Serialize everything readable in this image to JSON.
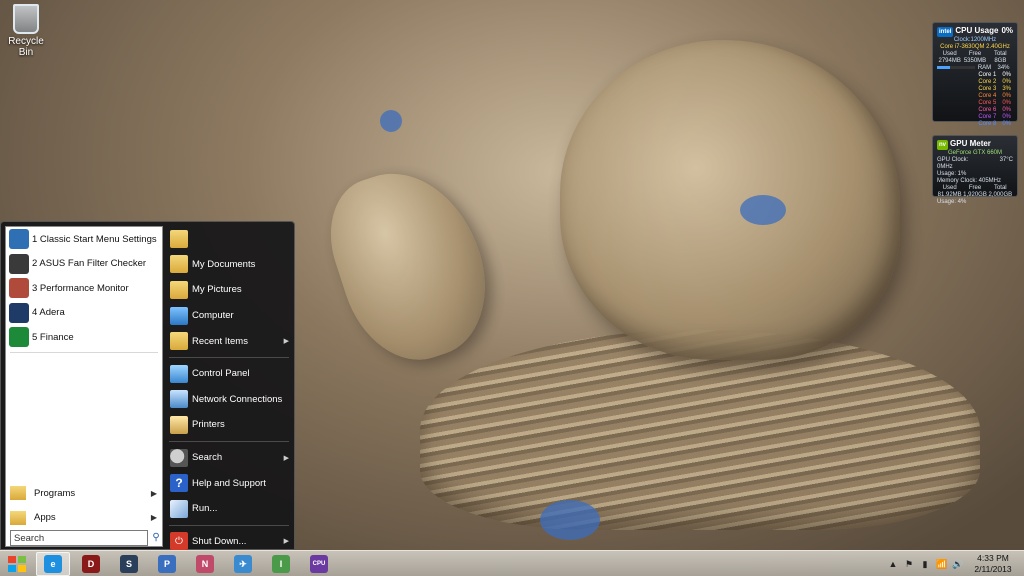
{
  "desktop": {
    "recycle_bin_label": "Recycle Bin"
  },
  "cpu_gadget": {
    "title": "CPU Usage",
    "percent": "0%",
    "clock": "Clock:1200MHz",
    "model": "Core i7-3630QM 2.40GHz",
    "headers": [
      "Used",
      "Free",
      "Total"
    ],
    "ram_values": [
      "2794MB",
      "5350MB",
      "8GB"
    ],
    "ram_label": "RAM",
    "ram_percent": "34%",
    "cores": [
      {
        "label": "Core 1",
        "value": "0%",
        "color": "#ffffff"
      },
      {
        "label": "Core 2",
        "value": "0%",
        "color": "#ffd84a"
      },
      {
        "label": "Core 3",
        "value": "3%",
        "color": "#ffd84a"
      },
      {
        "label": "Core 4",
        "value": "0%",
        "color": "#ff8a3a"
      },
      {
        "label": "Core 5",
        "value": "0%",
        "color": "#ff5a5a"
      },
      {
        "label": "Core 6",
        "value": "0%",
        "color": "#ff5aa8"
      },
      {
        "label": "Core 7",
        "value": "0%",
        "color": "#c05aff"
      },
      {
        "label": "Core 8",
        "value": "0%",
        "color": "#5a8aff"
      }
    ]
  },
  "gpu_gadget": {
    "title": "GPU Meter",
    "model": "GeForce GTX 660M",
    "gpu_clock": "GPU Clock: 0MHz",
    "temp": "37°C",
    "usage": "Usage: 1%",
    "memory_clock": "Memory Clock: 405MHz",
    "headers": [
      "Used",
      "Free",
      "Total"
    ],
    "mem_values": [
      "81.92MB",
      "1,920GB",
      "2,000GB"
    ],
    "mem_usage": "Usage: 4%"
  },
  "start_menu": {
    "pinned": [
      {
        "label": "1 Classic Start Menu Settings",
        "icon": "settings-shell-icon",
        "color": "#2f6fb3"
      },
      {
        "label": "2 ASUS Fan Filter Checker",
        "icon": "fan-icon",
        "color": "#3a3a3a"
      },
      {
        "label": "3 Performance Monitor",
        "icon": "gauge-icon",
        "color": "#b04a3a"
      },
      {
        "label": "4 Adera",
        "icon": "adera-icon",
        "color": "#1d3b66"
      },
      {
        "label": "5 Finance",
        "icon": "finance-chart-icon",
        "color": "#1d8a3a"
      }
    ],
    "programs_label": "Programs",
    "apps_label": "Apps",
    "search_placeholder": "Search",
    "right_items": {
      "user_folder": "",
      "my_documents": "My Documents",
      "my_pictures": "My Pictures",
      "computer": "Computer",
      "recent_items": "Recent Items",
      "control_panel": "Control Panel",
      "network_connections": "Network Connections",
      "printers": "Printers",
      "search": "Search",
      "help_support": "Help and Support",
      "run": "Run...",
      "shut_down": "Shut Down..."
    }
  },
  "taskbar": {
    "pinned": [
      {
        "name": "internet-explorer",
        "glyph": "e",
        "color": "#1f8fe0"
      },
      {
        "name": "diablo",
        "glyph": "D",
        "color": "#8a1a1a"
      },
      {
        "name": "steam",
        "glyph": "S",
        "color": "#2a3f5a"
      },
      {
        "name": "paint-app",
        "glyph": "P",
        "color": "#3a6fc0"
      },
      {
        "name": "network-tool",
        "glyph": "N",
        "color": "#c04a6a"
      },
      {
        "name": "airplane-app",
        "glyph": "✈",
        "color": "#3a8ad0"
      },
      {
        "name": "photo-app",
        "glyph": "I",
        "color": "#4a9a4a"
      },
      {
        "name": "cpu-z",
        "glyph": "CPU",
        "color": "#6a3aa0"
      }
    ],
    "clock_time": "4:33 PM",
    "clock_date": "2/11/2013"
  }
}
